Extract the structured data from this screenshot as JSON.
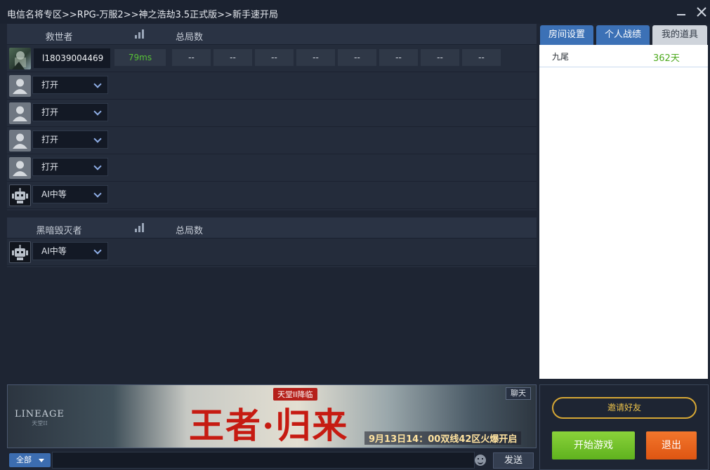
{
  "breadcrumb": "电信名将专区>>RPG-万服2>>神之浩劫3.5正式版>>新手速开局",
  "window": {
    "minimize_icon": "minimize-icon",
    "close_icon": "close-icon"
  },
  "team1": {
    "name": "救世者",
    "games_label": "总局数",
    "player": {
      "name": "l18039004469",
      "ping": "79ms",
      "stats": [
        "--",
        "--",
        "--",
        "--",
        "--",
        "--",
        "--",
        "--"
      ]
    },
    "slots": [
      {
        "type": "open",
        "value": "打开"
      },
      {
        "type": "open",
        "value": "打开"
      },
      {
        "type": "open",
        "value": "打开"
      },
      {
        "type": "open",
        "value": "打开"
      },
      {
        "type": "ai",
        "value": "AI中等"
      }
    ]
  },
  "team2": {
    "name": "黑暗毁灭者",
    "games_label": "总局数",
    "slots": [
      {
        "type": "ai",
        "value": "AI中等"
      }
    ]
  },
  "tabs": [
    "房间设置",
    "个人战绩",
    "我的道具"
  ],
  "items": [
    {
      "name": "九尾",
      "days": "362天"
    }
  ],
  "banner": {
    "brand": "LINEAGE",
    "brand_sub": "天堂II",
    "tag": "天堂II降临",
    "headline": "王者·归来",
    "date_text": "9月13日14：00双线42区火爆开启",
    "chat_label": "聊天"
  },
  "chat": {
    "channel": "全部",
    "send_label": "发送"
  },
  "actions": {
    "invite": "邀请好友",
    "start": "开始游戏",
    "quit": "退出"
  }
}
